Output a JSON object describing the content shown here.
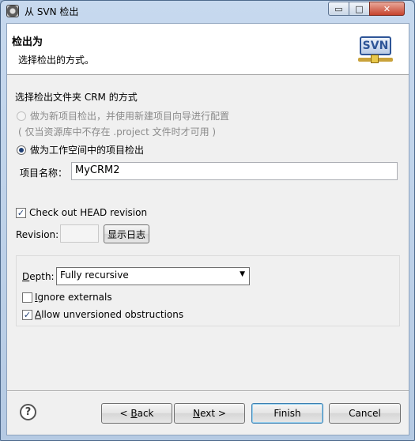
{
  "window": {
    "title": "从 SVN 检出",
    "min_glyph": "▭",
    "max_glyph": "□",
    "close_glyph": "✕"
  },
  "header": {
    "title": "检出为",
    "subtitle": "选择检出的方式。",
    "logo_text": "SVN"
  },
  "form": {
    "section_label": "选择检出文件夹 CRM 的方式",
    "option_new_project": "做为新项目检出，并使用新建项目向导进行配置",
    "option_note": "( 仅当资源库中不存在 .project 文件时才可用 )",
    "option_workspace": "做为工作空间中的项目检出",
    "project_name_label": "项目名称：",
    "project_name_value": "MyCRM2",
    "head_revision_label": "Check out HEAD revision",
    "revision_label": "Revision:",
    "revision_value": "",
    "show_log_button": "显示日志",
    "depth_label": "Depth:",
    "depth_value": "Fully recursive",
    "ignore_externals_label": "Ignore externals",
    "allow_unversioned_label": "Allow unversioned obstructions"
  },
  "checkboxes": {
    "head_revision": true,
    "ignore_externals": false,
    "allow_unversioned": true
  },
  "buttons": {
    "help": "?",
    "back": "< Back",
    "next": "Next >",
    "finish": "Finish",
    "cancel": "Cancel"
  }
}
